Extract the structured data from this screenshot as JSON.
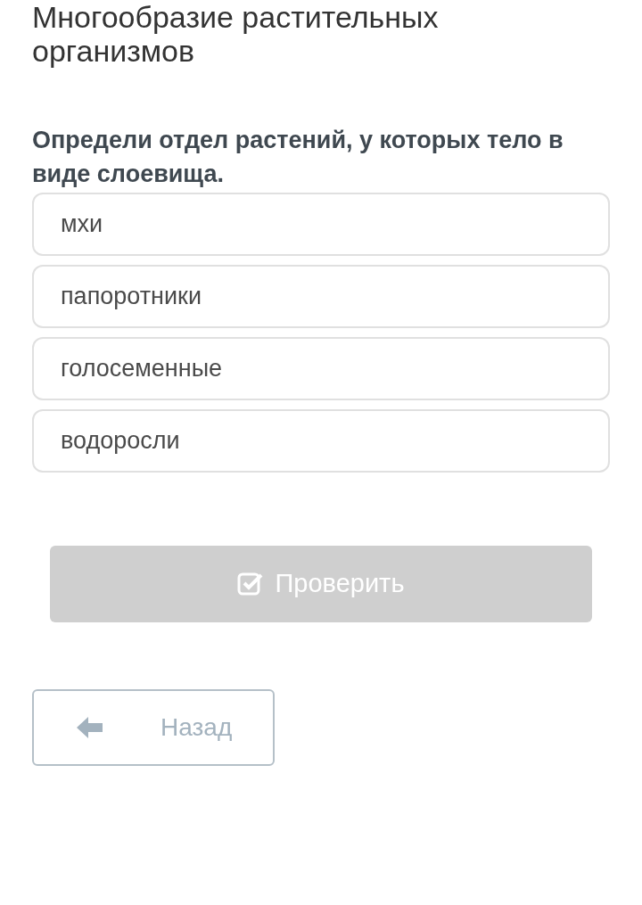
{
  "title": "Многообразие растительных организмов",
  "question": "Определи отдел растений, у которых тело в виде слоевища.",
  "options": [
    {
      "label": "мхи",
      "selected": false
    },
    {
      "label": "папоротники",
      "selected": false
    },
    {
      "label": "голосеменные",
      "selected": false
    },
    {
      "label": "водоросли",
      "selected": false
    }
  ],
  "check_button": {
    "label": "Проверить",
    "disabled": true
  },
  "back_button": {
    "label": "Назад"
  }
}
